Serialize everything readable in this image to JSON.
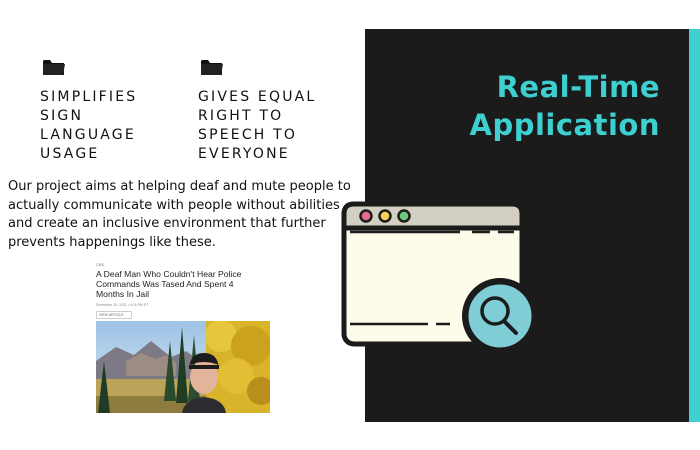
{
  "features": [
    {
      "icon": "folder-icon",
      "label": "SIMPLIFIES\nSIGN\nLANGUAGE\nUSAGE"
    },
    {
      "icon": "folder-icon",
      "label": "GIVES EQUAL\nRIGHT TO\nSPEECH TO\nEVERYONE"
    }
  ],
  "description": "Our project aims at helping deaf and mute people to actually communicate with people without abilities and create an inclusive environment that further prevents happenings like these.",
  "news": {
    "source": "CBS",
    "title": "A Deaf Man Who Couldn't Hear Police Commands Was Tased And Spent 4 Months In Jail",
    "date": "December 20, 2021 • 4:16 PM ET",
    "button": "VIEW ARTICLE"
  },
  "panel": {
    "heading_line1": "Real-Time",
    "heading_line2": "Application"
  },
  "colors": {
    "accent": "#3ecfd0",
    "panel_bg": "#1b1b1b",
    "browser_bg": "#fdfbea",
    "browser_bar": "#d3d0c3"
  },
  "icons": [
    "folder-icon",
    "browser-window-icon",
    "magnifier-icon"
  ]
}
